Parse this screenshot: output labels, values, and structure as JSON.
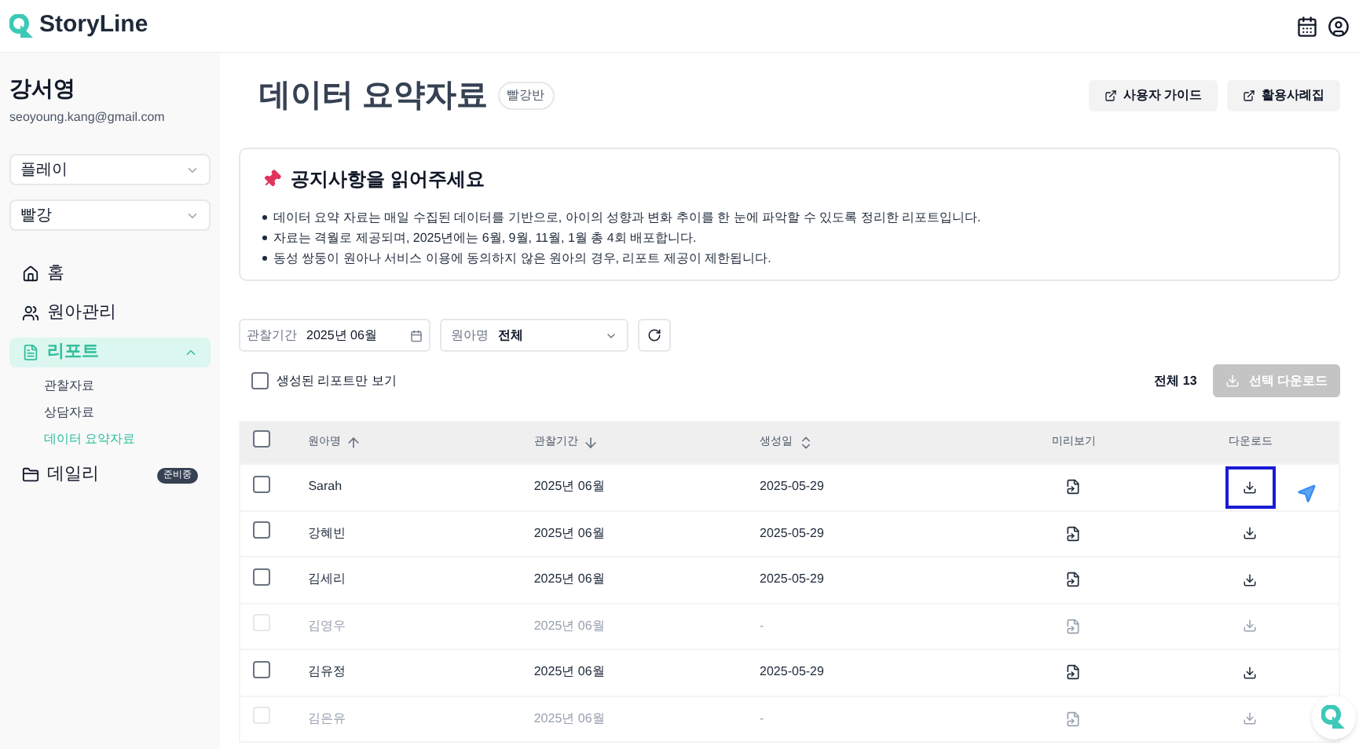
{
  "header": {
    "logo_text": "StoryLine"
  },
  "sidebar": {
    "user_name": "강서영",
    "email": "seoyoung.kang@gmail.com",
    "selects": [
      {
        "value": "플레이"
      },
      {
        "value": "빨강"
      }
    ],
    "nav": [
      {
        "label": "홈",
        "selected": false
      },
      {
        "label": "원아관리",
        "selected": false
      },
      {
        "label": "리포트",
        "selected": true,
        "expanded": true,
        "children": [
          {
            "label": "관찰자료",
            "selected": false
          },
          {
            "label": "상담자료",
            "selected": false
          },
          {
            "label": "데이터 요약자료",
            "selected": true
          }
        ]
      },
      {
        "label": "데일리",
        "selected": false,
        "badge": "준비중"
      }
    ]
  },
  "page": {
    "title": "데이터 요약자료",
    "tag": "빨강반",
    "buttons": [
      "사용자 가이드",
      "활용사례집"
    ]
  },
  "notice": {
    "title": "공지사항을 읽어주세요",
    "items": [
      "데이터 요약 자료는 매일 수집된 데이터를 기반으로, 아이의 성향과 변화 추이를 한 눈에 파악할 수 있도록 정리한 리포트입니다.",
      "자료는 격월로 제공되며, 2025년에는 6월, 9월, 11월, 1월 총 4회 배포합니다.",
      "동성 쌍둥이 원아나 서비스 이용에 동의하지 않은 원아의 경우, 리포트 제공이 제한됩니다."
    ]
  },
  "filters": {
    "period": {
      "label": "관찰기간",
      "value": "2025년 06월"
    },
    "child": {
      "label": "원아명",
      "value": "전체"
    }
  },
  "only_generated": {
    "label": "생성된 리포트만 보기",
    "checked": false
  },
  "total": "전체 13",
  "bulk_download": {
    "label": "선택 다운로드",
    "disabled": true
  },
  "table": {
    "select_all_checked": false,
    "columns": [
      {
        "label": "원아명",
        "sorted": true,
        "descending": false
      },
      {
        "label": "관찰기간",
        "sorted": true,
        "descending": true
      },
      {
        "label": "생성일",
        "sorted": false
      },
      {
        "label": "미리보기"
      },
      {
        "label": "다운로드"
      }
    ],
    "rows": [
      {
        "name": "Sarah",
        "period": "2025년 06월",
        "created": "2025-05-29",
        "checked": false,
        "disabled": false,
        "focused": true
      },
      {
        "name": "강혜빈",
        "period": "2025년 06월",
        "created": "2025-05-29",
        "checked": false,
        "disabled": false,
        "focused": false
      },
      {
        "name": "김세리",
        "period": "2025년 06월",
        "created": "2025-05-29",
        "checked": false,
        "disabled": false,
        "focused": false
      },
      {
        "name": "김영우",
        "period": "2025년 06월",
        "created": "-",
        "checked": false,
        "disabled": true,
        "focused": false
      },
      {
        "name": "김유정",
        "period": "2025년 06월",
        "created": "2025-05-29",
        "checked": false,
        "disabled": false,
        "focused": false
      },
      {
        "name": "김은유",
        "period": "2025년 06월",
        "created": "-",
        "checked": false,
        "disabled": true,
        "focused": false
      }
    ]
  }
}
